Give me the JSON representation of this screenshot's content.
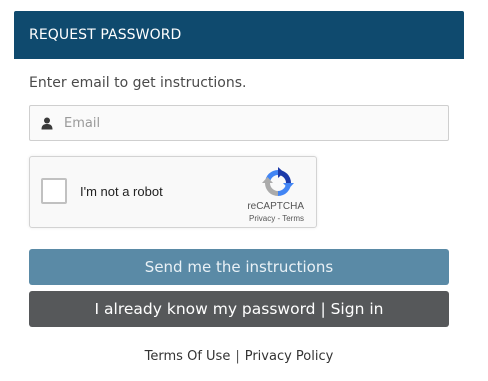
{
  "panel": {
    "title": "REQUEST PASSWORD",
    "header_color": "#0f4a6e"
  },
  "intro_text": "Enter email to get instructions.",
  "email": {
    "placeholder": "Email",
    "value": "",
    "icon": "user-icon"
  },
  "recaptcha": {
    "label": "I'm not a robot",
    "brand": "reCAPTCHA",
    "privacy": "Privacy",
    "separator": " - ",
    "terms": "Terms",
    "icon": "recaptcha-logo-icon"
  },
  "buttons": {
    "send": "Send me the instructions",
    "signin": "I already know my password | Sign in"
  },
  "footer": {
    "terms": "Terms Of Use",
    "separator": "|",
    "privacy": "Privacy Policy"
  }
}
